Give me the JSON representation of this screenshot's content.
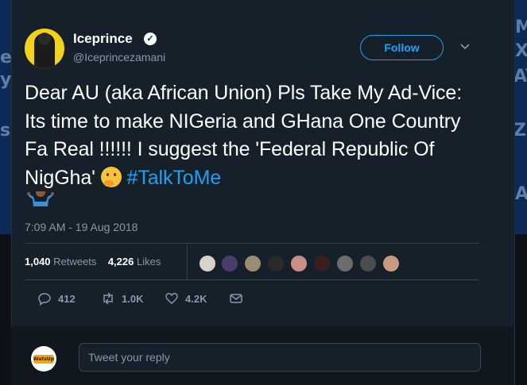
{
  "background": {
    "left_letters": [
      "e",
      "y",
      "s"
    ],
    "right_letters": [
      "M",
      "X",
      "AY",
      "Z)",
      "A"
    ]
  },
  "tweet": {
    "author_name": "Iceprince",
    "handle": "@Iceprincezamani",
    "verified_glyph": "✓",
    "follow_label": "Follow",
    "text_part1": "Dear AU (aka African Union) Pls Take My Ad-Vice: Its time to make NIGeria and GHana One Country Fa Real !!!!!! I suggest the 'Federal Republic Of NigGha' ",
    "hashtag": "#TalkToMe",
    "timestamp": "7:09 AM - 19 Aug 2018",
    "retweets_count": "1,040",
    "retweets_label": "Retweets",
    "likes_count": "4,226",
    "likes_label": "Likes",
    "likers_count": 9,
    "actions": {
      "replies": "412",
      "retweets": "1.0K",
      "likes": "4.2K"
    }
  },
  "reply": {
    "placeholder": "Tweet your reply",
    "avatar_label": "WatsUp"
  },
  "colors": {
    "accent": "#1da1f2",
    "card_bg": "#15202b",
    "text_secondary": "#8899a6"
  }
}
